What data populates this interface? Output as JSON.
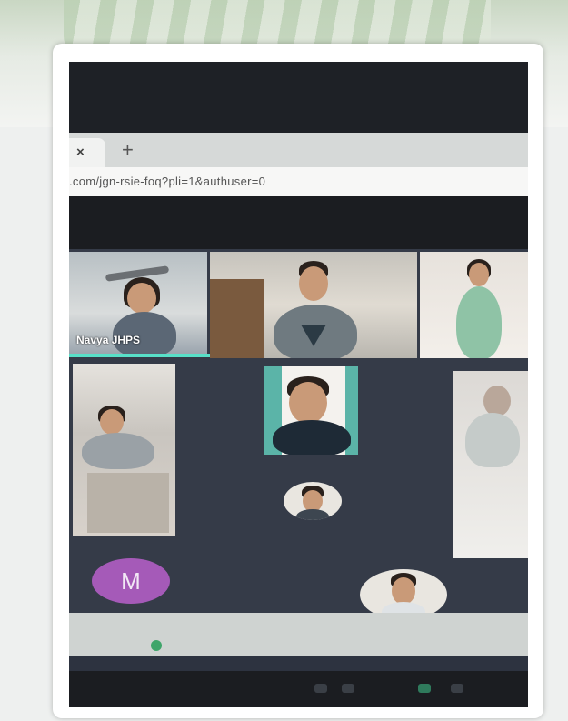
{
  "browser": {
    "tab_close_icon": "close-icon",
    "tab_close_label": "×",
    "new_tab_icon": "plus-icon",
    "new_tab_label": "+",
    "url_text": ".com/jgn-rsie-foq?pli=1&authuser=0"
  },
  "meeting": {
    "active_speaker_name": "Navya JHPS",
    "participant_initial": "M",
    "speaking_indicator_color": "#58e0c8",
    "initial_avatar_color": "#a55ab8"
  }
}
